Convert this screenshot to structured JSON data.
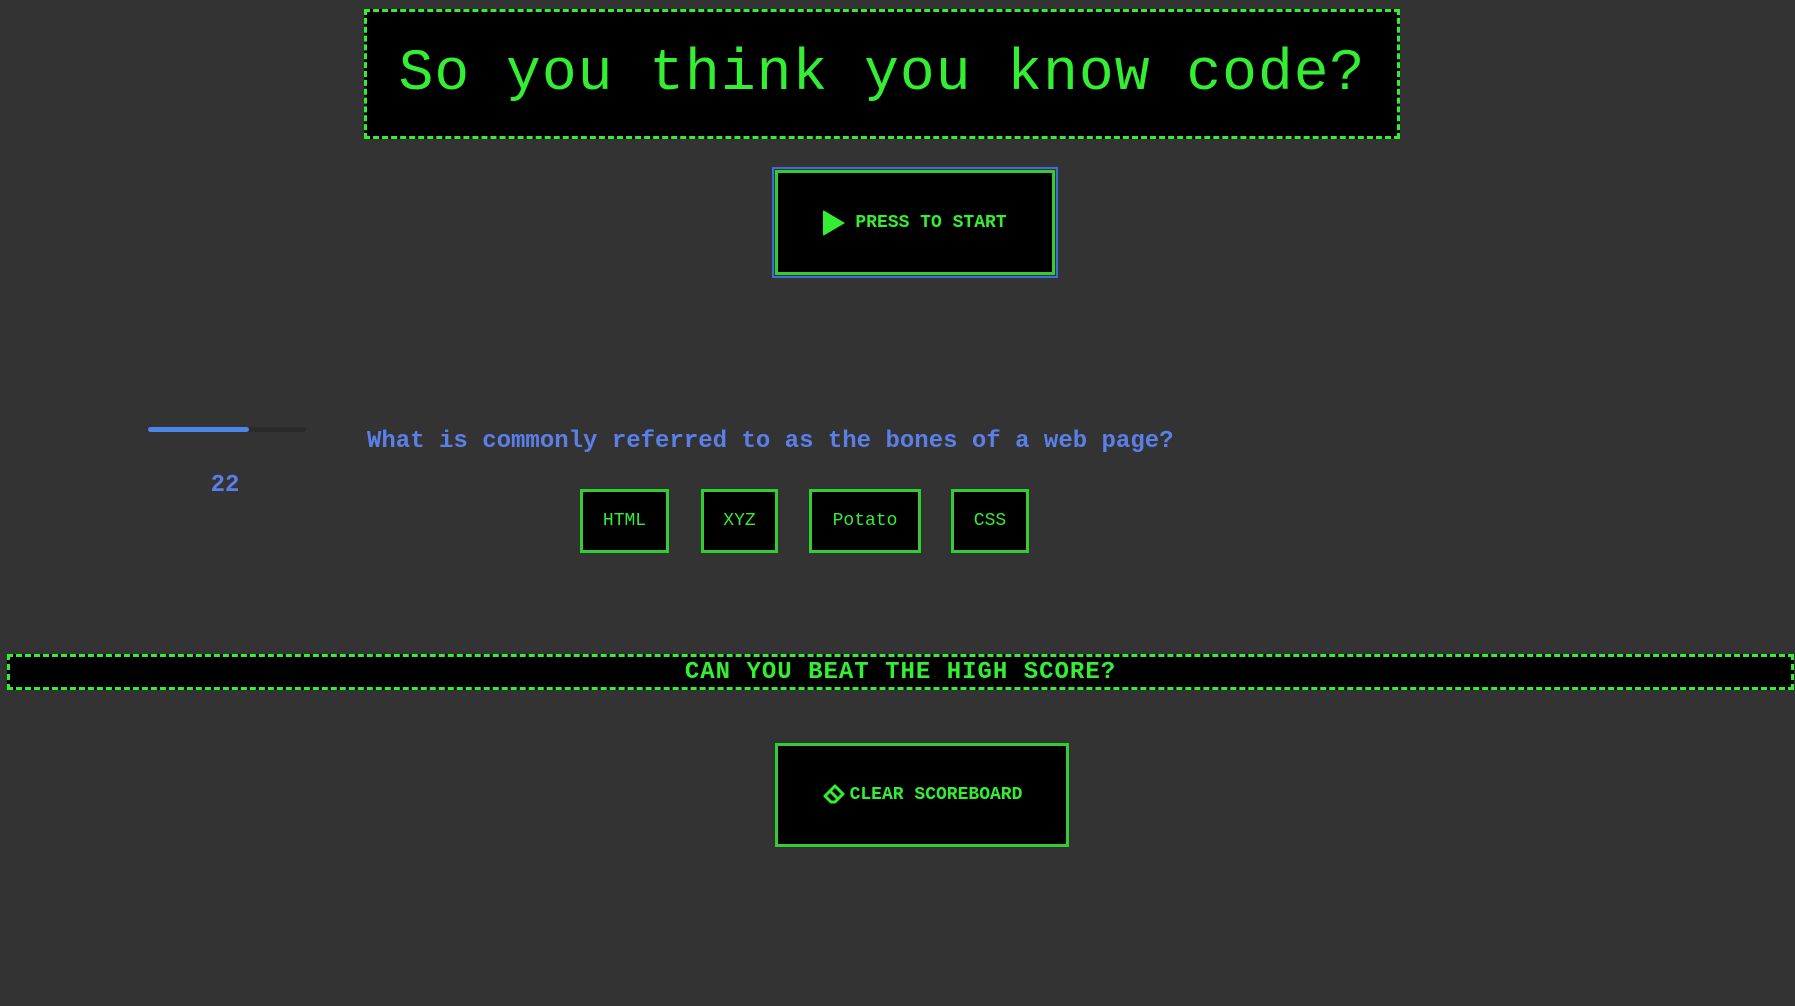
{
  "header": {
    "title": "So you think you know code?"
  },
  "start_button": {
    "label": "PRESS TO START",
    "icon": "play-icon"
  },
  "timer": {
    "remaining": "22",
    "progress_fraction": 0.64
  },
  "question": {
    "text": "What is commonly referred to as the bones of a web page?",
    "answers": [
      "HTML",
      "XYZ",
      "Potato",
      "CSS"
    ]
  },
  "highscore": {
    "banner": "CAN YOU BEAT THE HIGH SCORE?"
  },
  "clear_button": {
    "label": "CLEAR SCOREBOARD",
    "icon": "eraser-icon"
  },
  "colors": {
    "background": "#333333",
    "accent_green": "#33ee33",
    "accent_blue": "#5b7fe8"
  }
}
